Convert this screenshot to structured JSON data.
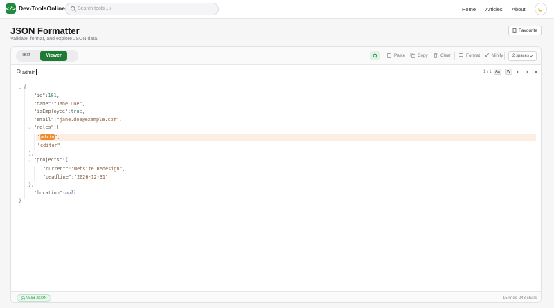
{
  "app": {
    "brand": "Dev-ToolsOnline",
    "logo_glyph": "</>"
  },
  "search": {
    "placeholder": "Search tools... /"
  },
  "nav": {
    "home": "Home",
    "articles": "Articles",
    "about": "About"
  },
  "page": {
    "title": "JSON Formatter",
    "subtitle": "Validate, format, and explore JSON data.",
    "favourite": "Favourite"
  },
  "toolbar": {
    "tab_text": "Text",
    "tab_viewer": "Viewer",
    "paste": "Paste",
    "copy": "Copy",
    "clear": "Clear",
    "format": "Format",
    "minify": "Minify",
    "indent": "2 spaces"
  },
  "find": {
    "query": "admin",
    "count": "1 / 1",
    "case_label": "Aa",
    "word_label": "W"
  },
  "json": {
    "open_brace": "{",
    "close_brace": "}",
    "id_key": "\"id\"",
    "id_val": "101",
    "name_key": "\"name\"",
    "name_val": "\"Jane Doe\"",
    "emp_key": "\"isEmployee\"",
    "emp_val": "true",
    "email_key": "\"email\"",
    "email_val": "\"jane.doe@example.com\"",
    "roles_key": "\"roles\"",
    "open_bracket": "[",
    "close_bracket": "],",
    "role1_q1": "\"",
    "role1": "admin",
    "role1_q2": "\"",
    "role2": "\"editor\"",
    "projects_key": "\"projects\"",
    "proj_open": "{",
    "proj_close": "},",
    "current_key": "\"current\"",
    "current_val": "\"Website Redesign\"",
    "deadline_key": "\"deadline\"",
    "deadline_val": "\"2026-12-31\"",
    "location_key": "\"location\"",
    "location_val": "null",
    "colon": ":",
    "comma": ","
  },
  "status": {
    "valid": "Valid JSON",
    "lines": "15 lines",
    "chars": "243 chars"
  },
  "colors": {
    "accent": "#1f7a34",
    "highlight": "#f08a2e"
  }
}
